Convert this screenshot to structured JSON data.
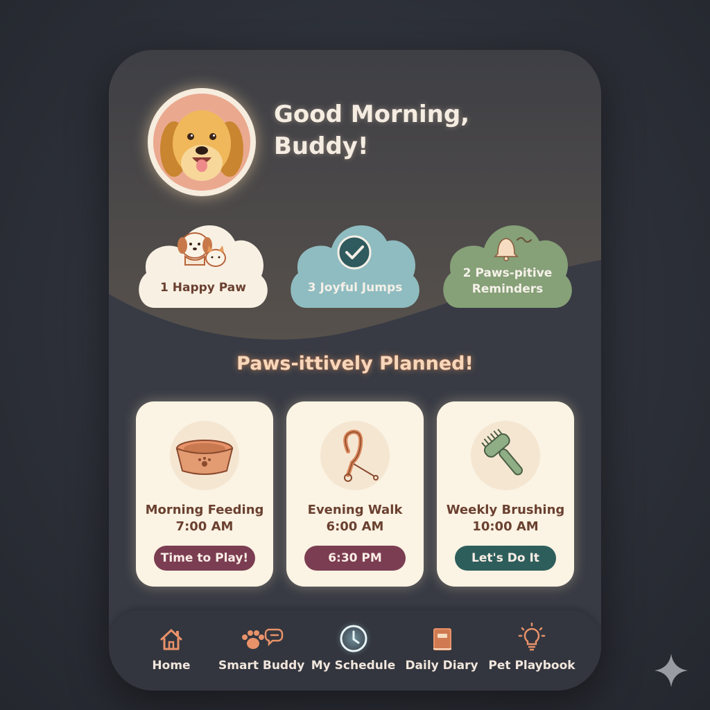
{
  "header": {
    "greeting_line1": "Good Morning,",
    "greeting_line2": "Buddy!",
    "avatar_icon": "golden-retriever-avatar"
  },
  "stats": [
    {
      "label": "1 Happy Paw",
      "icon": "dog-and-cat-icon",
      "color": "#f8f0e3"
    },
    {
      "label": "3 Joyful Jumps",
      "icon": "check-circle-icon",
      "color": "#8fbcc0"
    },
    {
      "label_line1": "2 Paws-pitive",
      "label_line2": "Reminders",
      "icon": "bell-icon",
      "color": "#86a078"
    }
  ],
  "section_title": "Paws-ittively Planned!",
  "tasks": [
    {
      "title": "Morning Feeding",
      "time": "7:00 AM",
      "button": "Time to Play!",
      "icon": "food-bowl-icon",
      "button_color": "#7b3d52"
    },
    {
      "title": "Evening Walk",
      "time": "6:00 AM",
      "button": "6:30 PM",
      "icon": "leash-icon",
      "button_color": "#7b3d52"
    },
    {
      "title": "Weekly Brushing",
      "time": "10:00 AM",
      "button": "Let's Do It",
      "icon": "brush-icon",
      "button_color": "#2e5e5c"
    }
  ],
  "tabs": [
    {
      "label": "Home",
      "icon": "home-icon"
    },
    {
      "label": "Smart Buddy",
      "icon": "paw-chat-icon"
    },
    {
      "label": "My Schedule",
      "icon": "clock-icon",
      "active": true
    },
    {
      "label": "Daily Diary",
      "icon": "diary-icon"
    },
    {
      "label": "Pet Playbook",
      "icon": "lightbulb-icon"
    }
  ],
  "colors": {
    "background": "#2c2f37",
    "panel": "#383b44",
    "hill": "#55504d",
    "accent": "#e8926a",
    "card": "#fbf3e3"
  }
}
